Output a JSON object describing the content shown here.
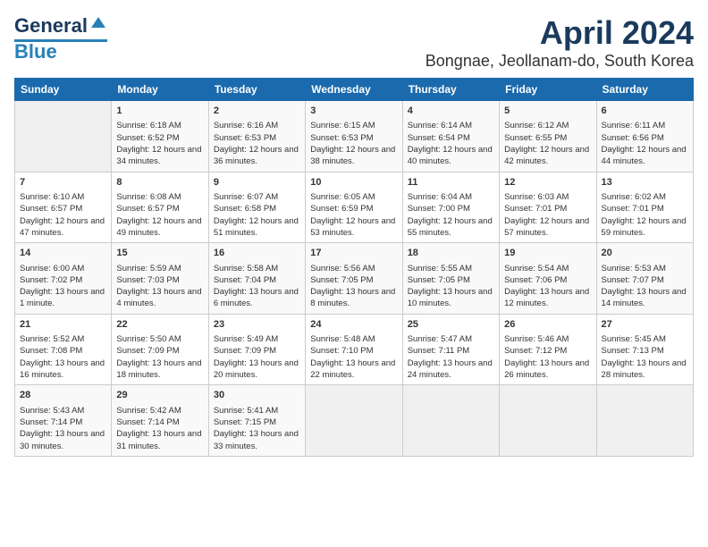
{
  "header": {
    "logo_main": "General",
    "logo_accent": "Blue",
    "month_title": "April 2024",
    "location": "Bongnae, Jeollanam-do, South Korea"
  },
  "days_of_week": [
    "Sunday",
    "Monday",
    "Tuesday",
    "Wednesday",
    "Thursday",
    "Friday",
    "Saturday"
  ],
  "weeks": [
    [
      {
        "day": "",
        "sunrise": "",
        "sunset": "",
        "daylight": ""
      },
      {
        "day": "1",
        "sunrise": "Sunrise: 6:18 AM",
        "sunset": "Sunset: 6:52 PM",
        "daylight": "Daylight: 12 hours and 34 minutes."
      },
      {
        "day": "2",
        "sunrise": "Sunrise: 6:16 AM",
        "sunset": "Sunset: 6:53 PM",
        "daylight": "Daylight: 12 hours and 36 minutes."
      },
      {
        "day": "3",
        "sunrise": "Sunrise: 6:15 AM",
        "sunset": "Sunset: 6:53 PM",
        "daylight": "Daylight: 12 hours and 38 minutes."
      },
      {
        "day": "4",
        "sunrise": "Sunrise: 6:14 AM",
        "sunset": "Sunset: 6:54 PM",
        "daylight": "Daylight: 12 hours and 40 minutes."
      },
      {
        "day": "5",
        "sunrise": "Sunrise: 6:12 AM",
        "sunset": "Sunset: 6:55 PM",
        "daylight": "Daylight: 12 hours and 42 minutes."
      },
      {
        "day": "6",
        "sunrise": "Sunrise: 6:11 AM",
        "sunset": "Sunset: 6:56 PM",
        "daylight": "Daylight: 12 hours and 44 minutes."
      }
    ],
    [
      {
        "day": "7",
        "sunrise": "Sunrise: 6:10 AM",
        "sunset": "Sunset: 6:57 PM",
        "daylight": "Daylight: 12 hours and 47 minutes."
      },
      {
        "day": "8",
        "sunrise": "Sunrise: 6:08 AM",
        "sunset": "Sunset: 6:57 PM",
        "daylight": "Daylight: 12 hours and 49 minutes."
      },
      {
        "day": "9",
        "sunrise": "Sunrise: 6:07 AM",
        "sunset": "Sunset: 6:58 PM",
        "daylight": "Daylight: 12 hours and 51 minutes."
      },
      {
        "day": "10",
        "sunrise": "Sunrise: 6:05 AM",
        "sunset": "Sunset: 6:59 PM",
        "daylight": "Daylight: 12 hours and 53 minutes."
      },
      {
        "day": "11",
        "sunrise": "Sunrise: 6:04 AM",
        "sunset": "Sunset: 7:00 PM",
        "daylight": "Daylight: 12 hours and 55 minutes."
      },
      {
        "day": "12",
        "sunrise": "Sunrise: 6:03 AM",
        "sunset": "Sunset: 7:01 PM",
        "daylight": "Daylight: 12 hours and 57 minutes."
      },
      {
        "day": "13",
        "sunrise": "Sunrise: 6:02 AM",
        "sunset": "Sunset: 7:01 PM",
        "daylight": "Daylight: 12 hours and 59 minutes."
      }
    ],
    [
      {
        "day": "14",
        "sunrise": "Sunrise: 6:00 AM",
        "sunset": "Sunset: 7:02 PM",
        "daylight": "Daylight: 13 hours and 1 minute."
      },
      {
        "day": "15",
        "sunrise": "Sunrise: 5:59 AM",
        "sunset": "Sunset: 7:03 PM",
        "daylight": "Daylight: 13 hours and 4 minutes."
      },
      {
        "day": "16",
        "sunrise": "Sunrise: 5:58 AM",
        "sunset": "Sunset: 7:04 PM",
        "daylight": "Daylight: 13 hours and 6 minutes."
      },
      {
        "day": "17",
        "sunrise": "Sunrise: 5:56 AM",
        "sunset": "Sunset: 7:05 PM",
        "daylight": "Daylight: 13 hours and 8 minutes."
      },
      {
        "day": "18",
        "sunrise": "Sunrise: 5:55 AM",
        "sunset": "Sunset: 7:05 PM",
        "daylight": "Daylight: 13 hours and 10 minutes."
      },
      {
        "day": "19",
        "sunrise": "Sunrise: 5:54 AM",
        "sunset": "Sunset: 7:06 PM",
        "daylight": "Daylight: 13 hours and 12 minutes."
      },
      {
        "day": "20",
        "sunrise": "Sunrise: 5:53 AM",
        "sunset": "Sunset: 7:07 PM",
        "daylight": "Daylight: 13 hours and 14 minutes."
      }
    ],
    [
      {
        "day": "21",
        "sunrise": "Sunrise: 5:52 AM",
        "sunset": "Sunset: 7:08 PM",
        "daylight": "Daylight: 13 hours and 16 minutes."
      },
      {
        "day": "22",
        "sunrise": "Sunrise: 5:50 AM",
        "sunset": "Sunset: 7:09 PM",
        "daylight": "Daylight: 13 hours and 18 minutes."
      },
      {
        "day": "23",
        "sunrise": "Sunrise: 5:49 AM",
        "sunset": "Sunset: 7:09 PM",
        "daylight": "Daylight: 13 hours and 20 minutes."
      },
      {
        "day": "24",
        "sunrise": "Sunrise: 5:48 AM",
        "sunset": "Sunset: 7:10 PM",
        "daylight": "Daylight: 13 hours and 22 minutes."
      },
      {
        "day": "25",
        "sunrise": "Sunrise: 5:47 AM",
        "sunset": "Sunset: 7:11 PM",
        "daylight": "Daylight: 13 hours and 24 minutes."
      },
      {
        "day": "26",
        "sunrise": "Sunrise: 5:46 AM",
        "sunset": "Sunset: 7:12 PM",
        "daylight": "Daylight: 13 hours and 26 minutes."
      },
      {
        "day": "27",
        "sunrise": "Sunrise: 5:45 AM",
        "sunset": "Sunset: 7:13 PM",
        "daylight": "Daylight: 13 hours and 28 minutes."
      }
    ],
    [
      {
        "day": "28",
        "sunrise": "Sunrise: 5:43 AM",
        "sunset": "Sunset: 7:14 PM",
        "daylight": "Daylight: 13 hours and 30 minutes."
      },
      {
        "day": "29",
        "sunrise": "Sunrise: 5:42 AM",
        "sunset": "Sunset: 7:14 PM",
        "daylight": "Daylight: 13 hours and 31 minutes."
      },
      {
        "day": "30",
        "sunrise": "Sunrise: 5:41 AM",
        "sunset": "Sunset: 7:15 PM",
        "daylight": "Daylight: 13 hours and 33 minutes."
      },
      {
        "day": "",
        "sunrise": "",
        "sunset": "",
        "daylight": ""
      },
      {
        "day": "",
        "sunrise": "",
        "sunset": "",
        "daylight": ""
      },
      {
        "day": "",
        "sunrise": "",
        "sunset": "",
        "daylight": ""
      },
      {
        "day": "",
        "sunrise": "",
        "sunset": "",
        "daylight": ""
      }
    ]
  ]
}
